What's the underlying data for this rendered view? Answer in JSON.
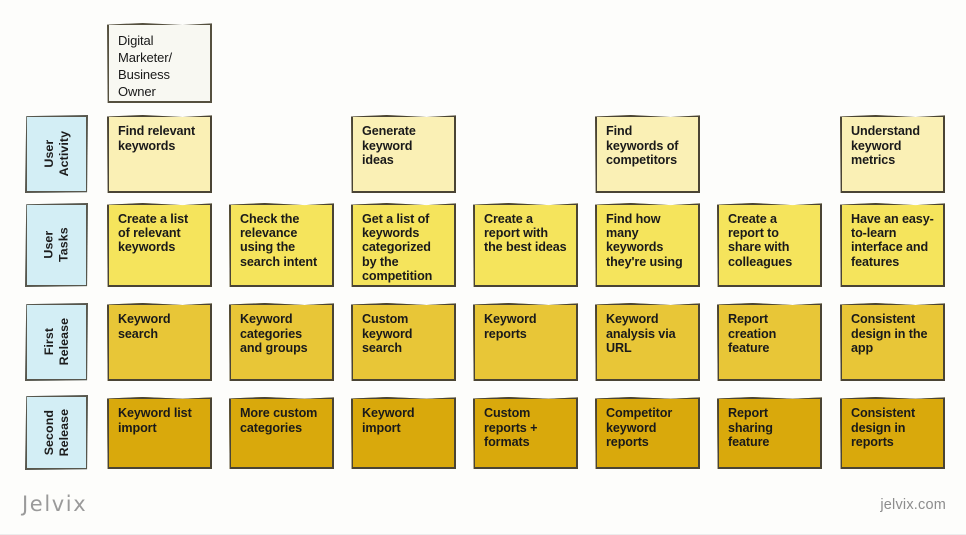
{
  "board": {
    "background_color": "#fdfdfb",
    "persona": {
      "label": "Digital Marketer/ Business Owner",
      "color": "#f8f8f2"
    },
    "columns": 7,
    "rows": [
      {
        "id": "user-activity",
        "label": "User\nActivity",
        "label_color": "#d3eef5",
        "card_color": "#faf0b5",
        "cards": [
          "Find relevant keywords",
          "",
          "Generate keyword ideas",
          "",
          "Find keywords of competitors",
          "",
          "Understand keyword metrics"
        ]
      },
      {
        "id": "user-tasks",
        "label": "User\nTasks",
        "label_color": "#d3eef5",
        "card_color": "#f5e45c",
        "cards": [
          "Create a list of relevant keywords",
          "Check the relevance using the search intent",
          "Get a list of keywords categorized by the competition",
          "Create a report with the best ideas",
          "Find how many keywords they're using",
          "Create a report to share with colleagues",
          "Have an easy-to-learn interface and features"
        ]
      },
      {
        "id": "first-release",
        "label": "First\nRelease",
        "label_color": "#d3eef5",
        "card_color": "#e8c637",
        "cards": [
          "Keyword search",
          "Keyword categories and groups",
          "Custom keyword search",
          "Keyword reports",
          "Keyword analysis via URL",
          "Report creation feature",
          "Consistent design in the app"
        ]
      },
      {
        "id": "second-release",
        "label": "Second\nRelease",
        "label_color": "#d3eef5",
        "card_color": "#d9a90c",
        "cards": [
          "Keyword list import",
          "More custom categories",
          "Keyword import",
          "Custom reports + formats",
          "Competitor keyword reports",
          "Report sharing feature",
          "Consistent design in reports"
        ]
      }
    ]
  },
  "footer": {
    "brand": "Jelvix",
    "website": "jelvix.com"
  }
}
